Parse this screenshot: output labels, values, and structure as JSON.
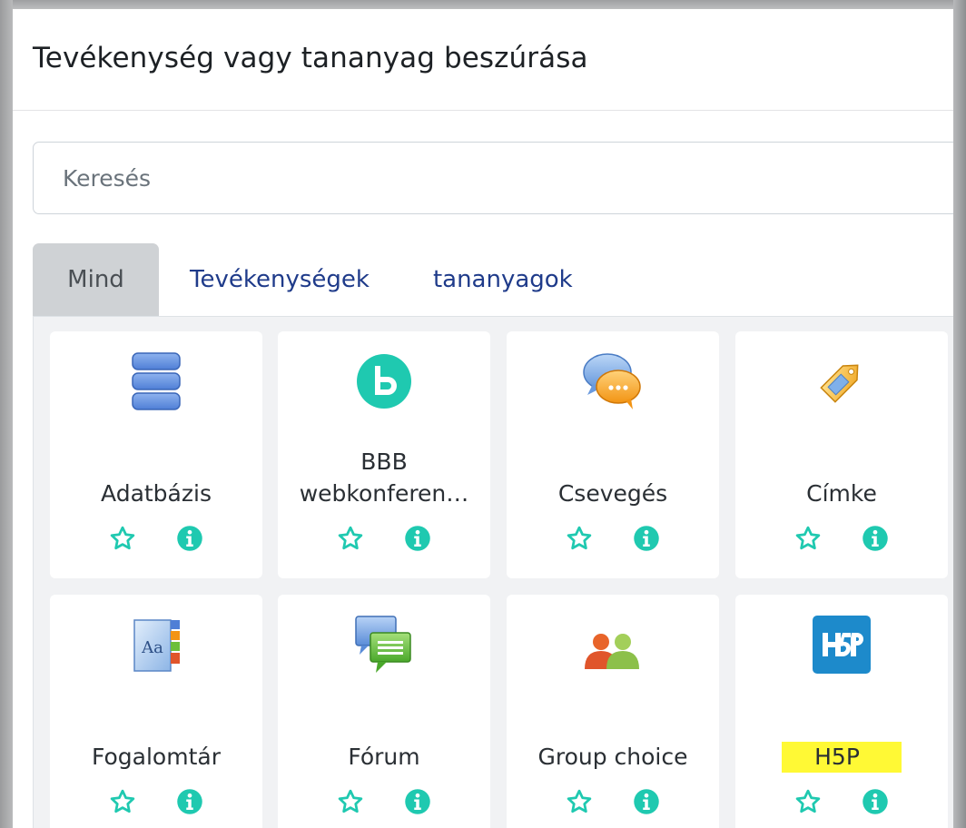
{
  "modal": {
    "title": "Tevékenység vagy tananyag beszúrása"
  },
  "search": {
    "placeholder": "Keresés"
  },
  "tabs": [
    {
      "label": "Mind",
      "active": true
    },
    {
      "label": "Tevékenységek",
      "active": false
    },
    {
      "label": "tananyagok",
      "active": false
    }
  ],
  "colors": {
    "accent": "#1fc9b0",
    "link": "#1f3b8a",
    "highlight": "#fff935"
  },
  "items": [
    {
      "label": "Adatbázis",
      "icon": "database-icon"
    },
    {
      "label": "BBB\nwebkonferen…",
      "icon": "bigbluebutton-icon"
    },
    {
      "label": "Csevegés",
      "icon": "chat-icon"
    },
    {
      "label": "Címke",
      "icon": "label-tag-icon"
    },
    {
      "label": "Fogalomtár",
      "icon": "glossary-icon"
    },
    {
      "label": "Fórum",
      "icon": "forum-icon"
    },
    {
      "label": "Group choice",
      "icon": "group-choice-icon"
    },
    {
      "label": "H5P",
      "icon": "h5p-icon"
    }
  ]
}
